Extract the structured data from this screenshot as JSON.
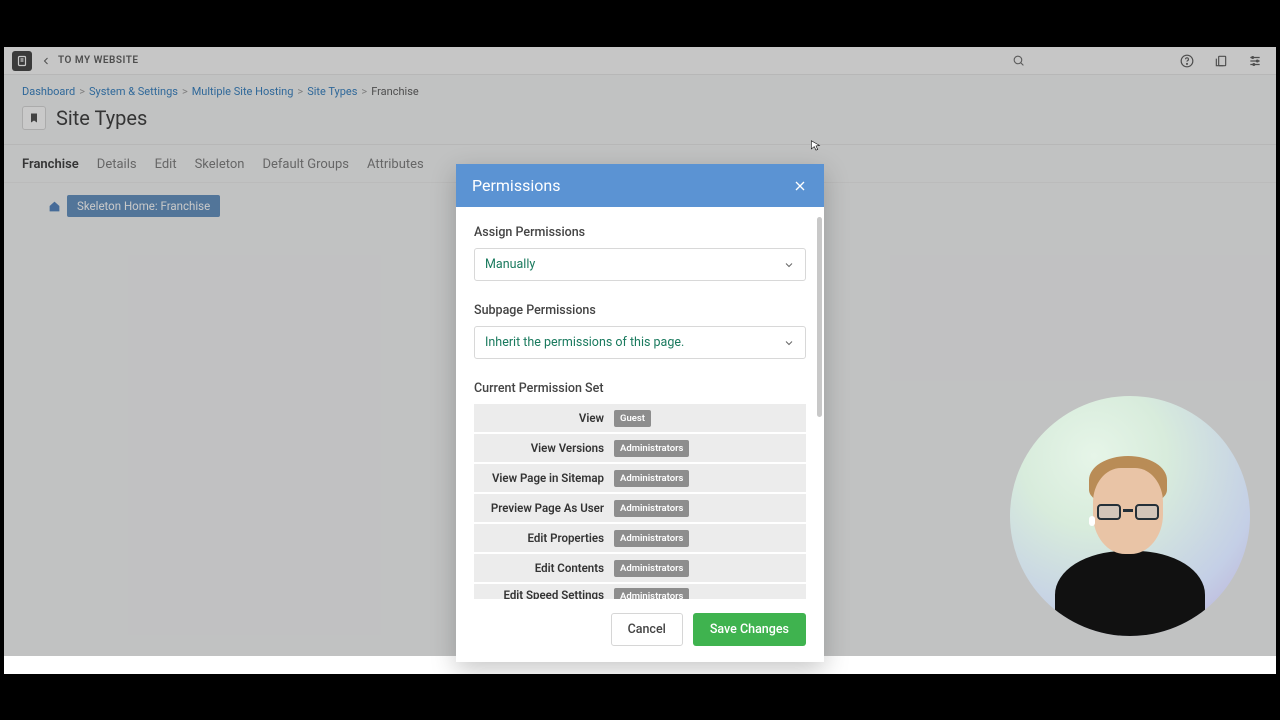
{
  "topbar": {
    "back_label": "TO MY WEBSITE"
  },
  "breadcrumb": {
    "items": [
      "Dashboard",
      "System & Settings",
      "Multiple Site Hosting",
      "Site Types",
      "Franchise"
    ]
  },
  "page": {
    "title": "Site Types"
  },
  "tabs": {
    "active_name": "Franchise",
    "items": [
      "Details",
      "Edit",
      "Skeleton",
      "Default Groups",
      "Attributes"
    ]
  },
  "skeleton_chip": "Skeleton Home: Franchise",
  "modal": {
    "title": "Permissions",
    "assign_label": "Assign Permissions",
    "assign_value": "Manually",
    "subpage_label": "Subpage Permissions",
    "subpage_value": "Inherit the permissions of this page.",
    "current_set_label": "Current Permission Set",
    "rows": [
      {
        "name": "View",
        "badge": "Guest"
      },
      {
        "name": "View Versions",
        "badge": "Administrators"
      },
      {
        "name": "View Page in Sitemap",
        "badge": "Administrators"
      },
      {
        "name": "Preview Page As User",
        "badge": "Administrators"
      },
      {
        "name": "Edit Properties",
        "badge": "Administrators"
      },
      {
        "name": "Edit Contents",
        "badge": "Administrators"
      },
      {
        "name": "Edit Speed Settings",
        "badge": "Administrators"
      }
    ],
    "cancel": "Cancel",
    "save": "Save Changes"
  }
}
